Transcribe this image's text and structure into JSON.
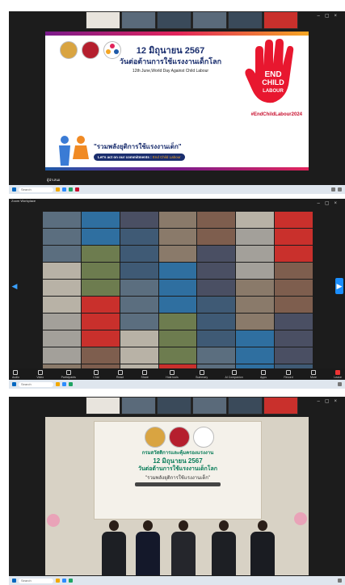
{
  "screen1": {
    "slide": {
      "date_th": "12 มิถุนายน 2567",
      "title_th": "วันต่อต้านการใช้แรงงานเด็กโลก",
      "title_en": "12th June,World Day Against Child Labour",
      "hand_text_1": "END",
      "hand_text_2": "CHILD",
      "hand_text_3": "LABOUR",
      "hashtag": "#EndChildLabour2024",
      "slogan_th": "\"รวมพลังยุติการใช้แรงงานเด็ก\"",
      "commit_text": "Let's act on our commitments :",
      "commit_highlight": "End Child Labour"
    },
    "speaker_label": "ผู้นำเสนอ",
    "taskbar_search": "Search"
  },
  "screen2": {
    "app_title": "Zoom Workplace",
    "taskbar_search": "Search",
    "controls": [
      "Audio",
      "Video",
      "Participants",
      "Chat",
      "React",
      "Share",
      "Host tools",
      "Summary",
      "AI Companion",
      "Apps",
      "Record",
      "More",
      "Leave"
    ]
  },
  "screen3": {
    "banner_org": "กรมสวัสดิการและคุ้มครองแรงงาน",
    "banner_title": "12 มิถุนายน 2567",
    "banner_sub": "วันต่อต้านการใช้แรงงานเด็กโลก",
    "banner_slogan": "\"รวมพลังยุติการใช้แรงงานเด็ก\"",
    "taskbar_search": "Search"
  },
  "colors": {
    "brand_red": "#e2245b",
    "zoom_blue": "#1b8fff",
    "navy": "#1a2e6e"
  },
  "icons": [
    "search-icon",
    "hand-icon",
    "chevron-left-icon",
    "chevron-right-icon",
    "leave-icon"
  ]
}
